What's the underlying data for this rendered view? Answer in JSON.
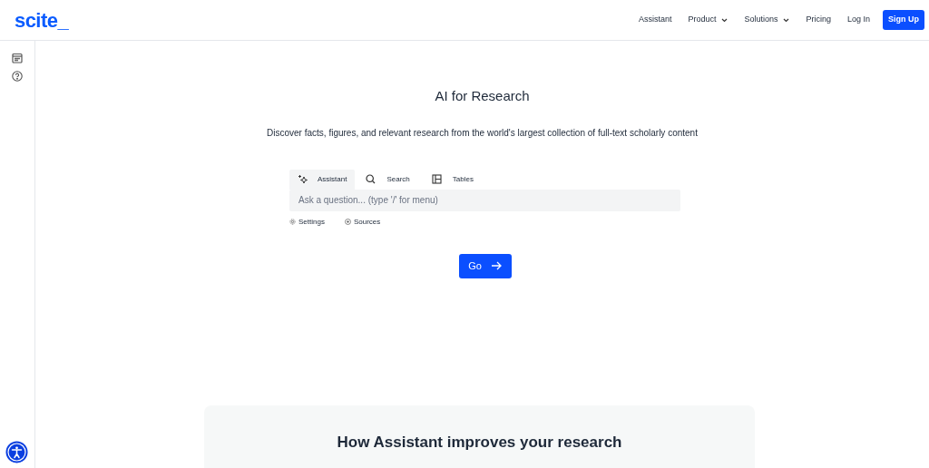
{
  "header": {
    "logo": "scite_",
    "nav": [
      {
        "label": "Assistant",
        "dropdown": false
      },
      {
        "label": "Product",
        "dropdown": true
      },
      {
        "label": "Solutions",
        "dropdown": true
      },
      {
        "label": "Pricing",
        "dropdown": false
      },
      {
        "label": "Log In",
        "dropdown": false
      }
    ],
    "signup": "Sign Up"
  },
  "hero": {
    "title": "AI for Research",
    "subtitle": "Discover facts, figures, and relevant research from the world's largest collection of full-text scholarly content"
  },
  "tabs": [
    {
      "label": "Assistant",
      "kind": "sparkle",
      "selected": true
    },
    {
      "label": "Search",
      "kind": "search",
      "selected": false
    },
    {
      "label": "Tables",
      "kind": "table",
      "selected": false
    }
  ],
  "query": {
    "placeholder": "Ask a question... (type '/' for menu)"
  },
  "options": [
    {
      "label": "Settings",
      "kind": "gear"
    },
    {
      "label": "Sources",
      "kind": "plus"
    }
  ],
  "go_button": "Go",
  "section": {
    "title": "How Assistant improves your research"
  }
}
